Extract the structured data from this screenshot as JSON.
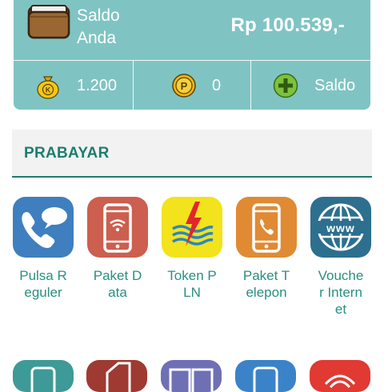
{
  "balance": {
    "label": "Saldo\nAnda",
    "amount": "Rp 100.539,-",
    "stats": [
      {
        "icon": "money-bag-icon",
        "value": "1.200"
      },
      {
        "icon": "coin-p-icon",
        "value": "0"
      },
      {
        "icon": "add-circle-icon",
        "value": "Saldo"
      }
    ]
  },
  "section": {
    "title": "PRABAYAR"
  },
  "services": [
    {
      "icon": "phone-chat-icon",
      "label": "Pulsa Reguler",
      "color": "#3f7fbf"
    },
    {
      "icon": "smartphone-wifi-icon",
      "label": "Paket Data",
      "color": "#cc5f4f"
    },
    {
      "icon": "pln-lightning-icon",
      "label": "Token PLN",
      "color": "#f2e31c"
    },
    {
      "icon": "smartphone-call-icon",
      "label": "Paket Telepon",
      "color": "#e08a34"
    },
    {
      "icon": "www-globe-icon",
      "label": "Voucher Internet",
      "color": "#2d6f8f"
    }
  ],
  "colors": {
    "card": "#7fc4c3",
    "accent": "#1d7d6e",
    "label": "#2a8f80"
  }
}
